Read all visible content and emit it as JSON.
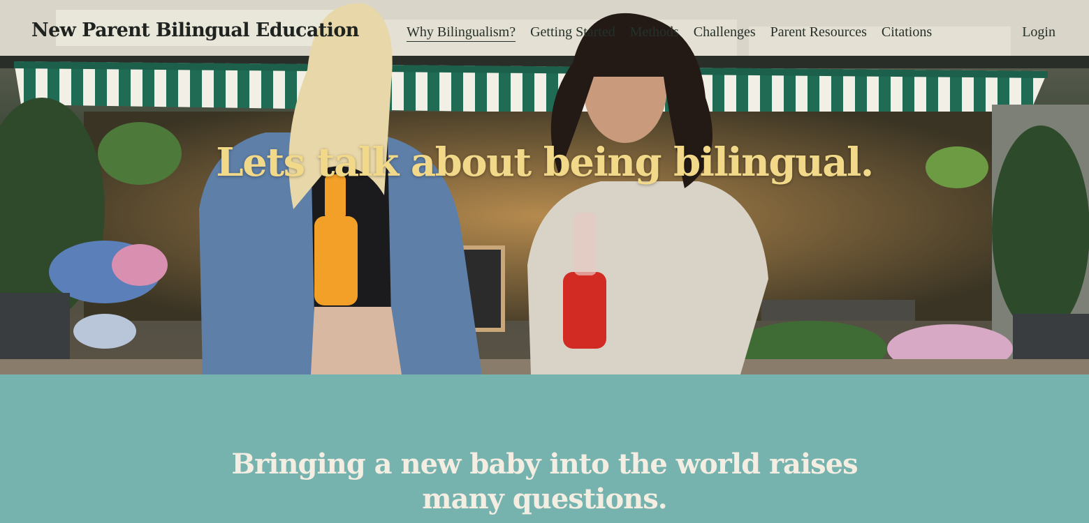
{
  "header": {
    "site_title": "New Parent Bilingual Education",
    "nav": [
      {
        "label": "Why Bilingualism?",
        "active": true
      },
      {
        "label": "Getting Started",
        "active": false
      },
      {
        "label": "Methods",
        "active": false
      },
      {
        "label": "Challenges",
        "active": false
      },
      {
        "label": "Parent Resources",
        "active": false
      },
      {
        "label": "Citations",
        "active": false
      }
    ],
    "login_label": "Login"
  },
  "hero": {
    "heading": "Lets talk about being bilingual.",
    "image": "photo of two smiling women holding soda bottles in front of a flower shop with a striped awning"
  },
  "intro": {
    "heading": "Bringing a new baby into the world raises many questions."
  },
  "colors": {
    "hero_heading": "#f2d98a",
    "section_background": "#77b3ae",
    "section_heading": "#f3ede2",
    "text_dark": "#26302a"
  }
}
